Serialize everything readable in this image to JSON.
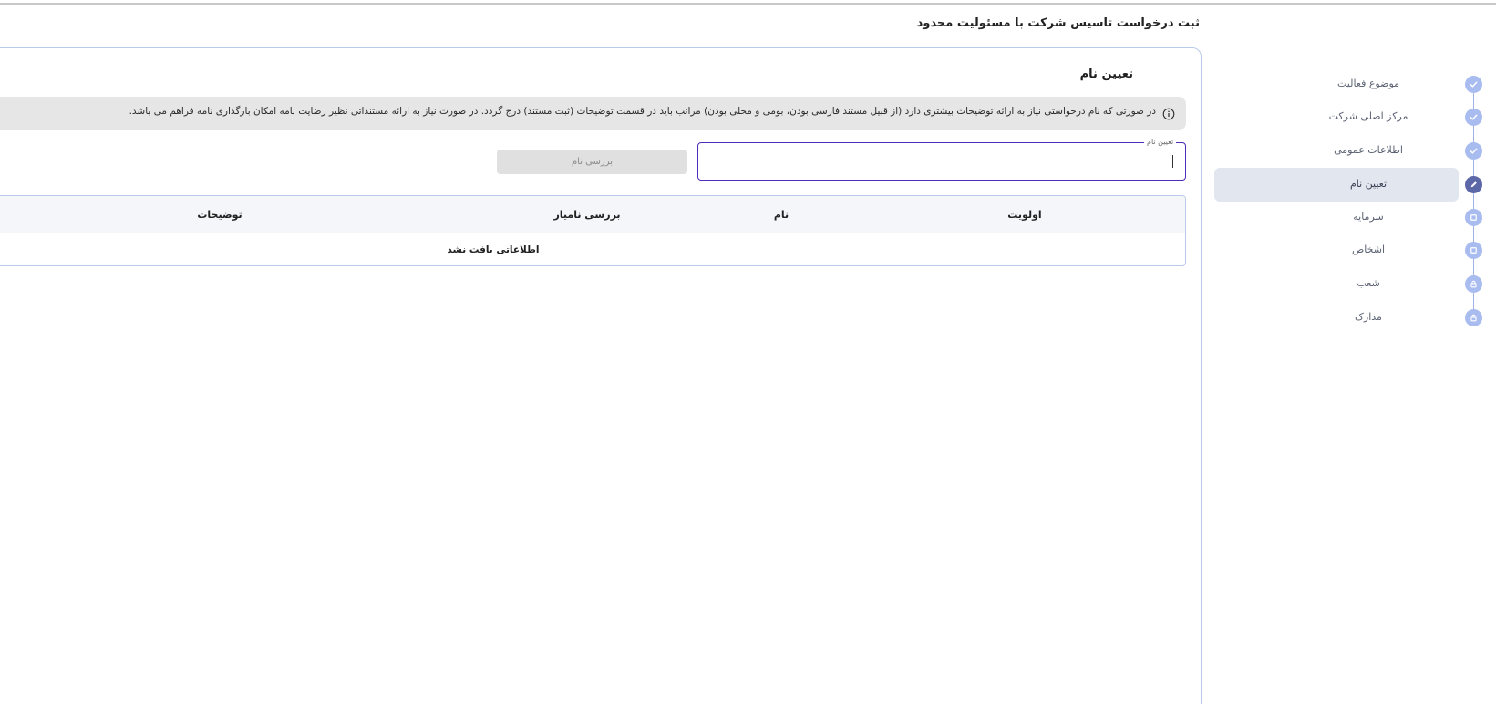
{
  "page_title": "ثبت درخواست تاسیس شرکت با مسئولیت محدود",
  "steps": [
    {
      "label": "موضوع فعالیت",
      "status": "done",
      "icon": "check-icon"
    },
    {
      "label": "مرکز اصلی شرکت",
      "status": "done",
      "icon": "check-icon"
    },
    {
      "label": "اطلاعات عمومی",
      "status": "done",
      "icon": "check-icon"
    },
    {
      "label": "تعیین نام",
      "status": "active",
      "icon": "pencil-icon"
    },
    {
      "label": "سرمایه",
      "status": "pending",
      "icon": "square-icon"
    },
    {
      "label": "اشخاص",
      "status": "pending",
      "icon": "square-icon"
    },
    {
      "label": "شعب",
      "status": "locked",
      "icon": "lock-icon"
    },
    {
      "label": "مدارک",
      "status": "locked",
      "icon": "lock-icon"
    }
  ],
  "section": {
    "title": "تعیین نام",
    "info": "در صورتی که نام درخواستی نیاز به ارائه توضیحات بیشتری دارد (از قبیل مستند فارسی بودن، بومی و محلی بودن) مراتب باید در قسمت توضیحات (ثبت مستند) درج گردد. در صورت نیاز به ارائه مستنداتی نظیر رضایت نامه امکان بارگذاری نامه فراهم می باشد.",
    "name_field": {
      "label": "تعیین نام",
      "value": ""
    },
    "check_button": "بررسی نام"
  },
  "table": {
    "headers": {
      "priority": "اولویت",
      "name": "نام",
      "check": "بررسی نامیار",
      "description": "توضیحات"
    },
    "empty_message": "اطلاعاتی یافت نشد"
  },
  "colors": {
    "accent": "#4e2bb8",
    "step_done": "#a9bcf0",
    "step_active": "#5c67a8",
    "border": "#b9cbe8"
  }
}
